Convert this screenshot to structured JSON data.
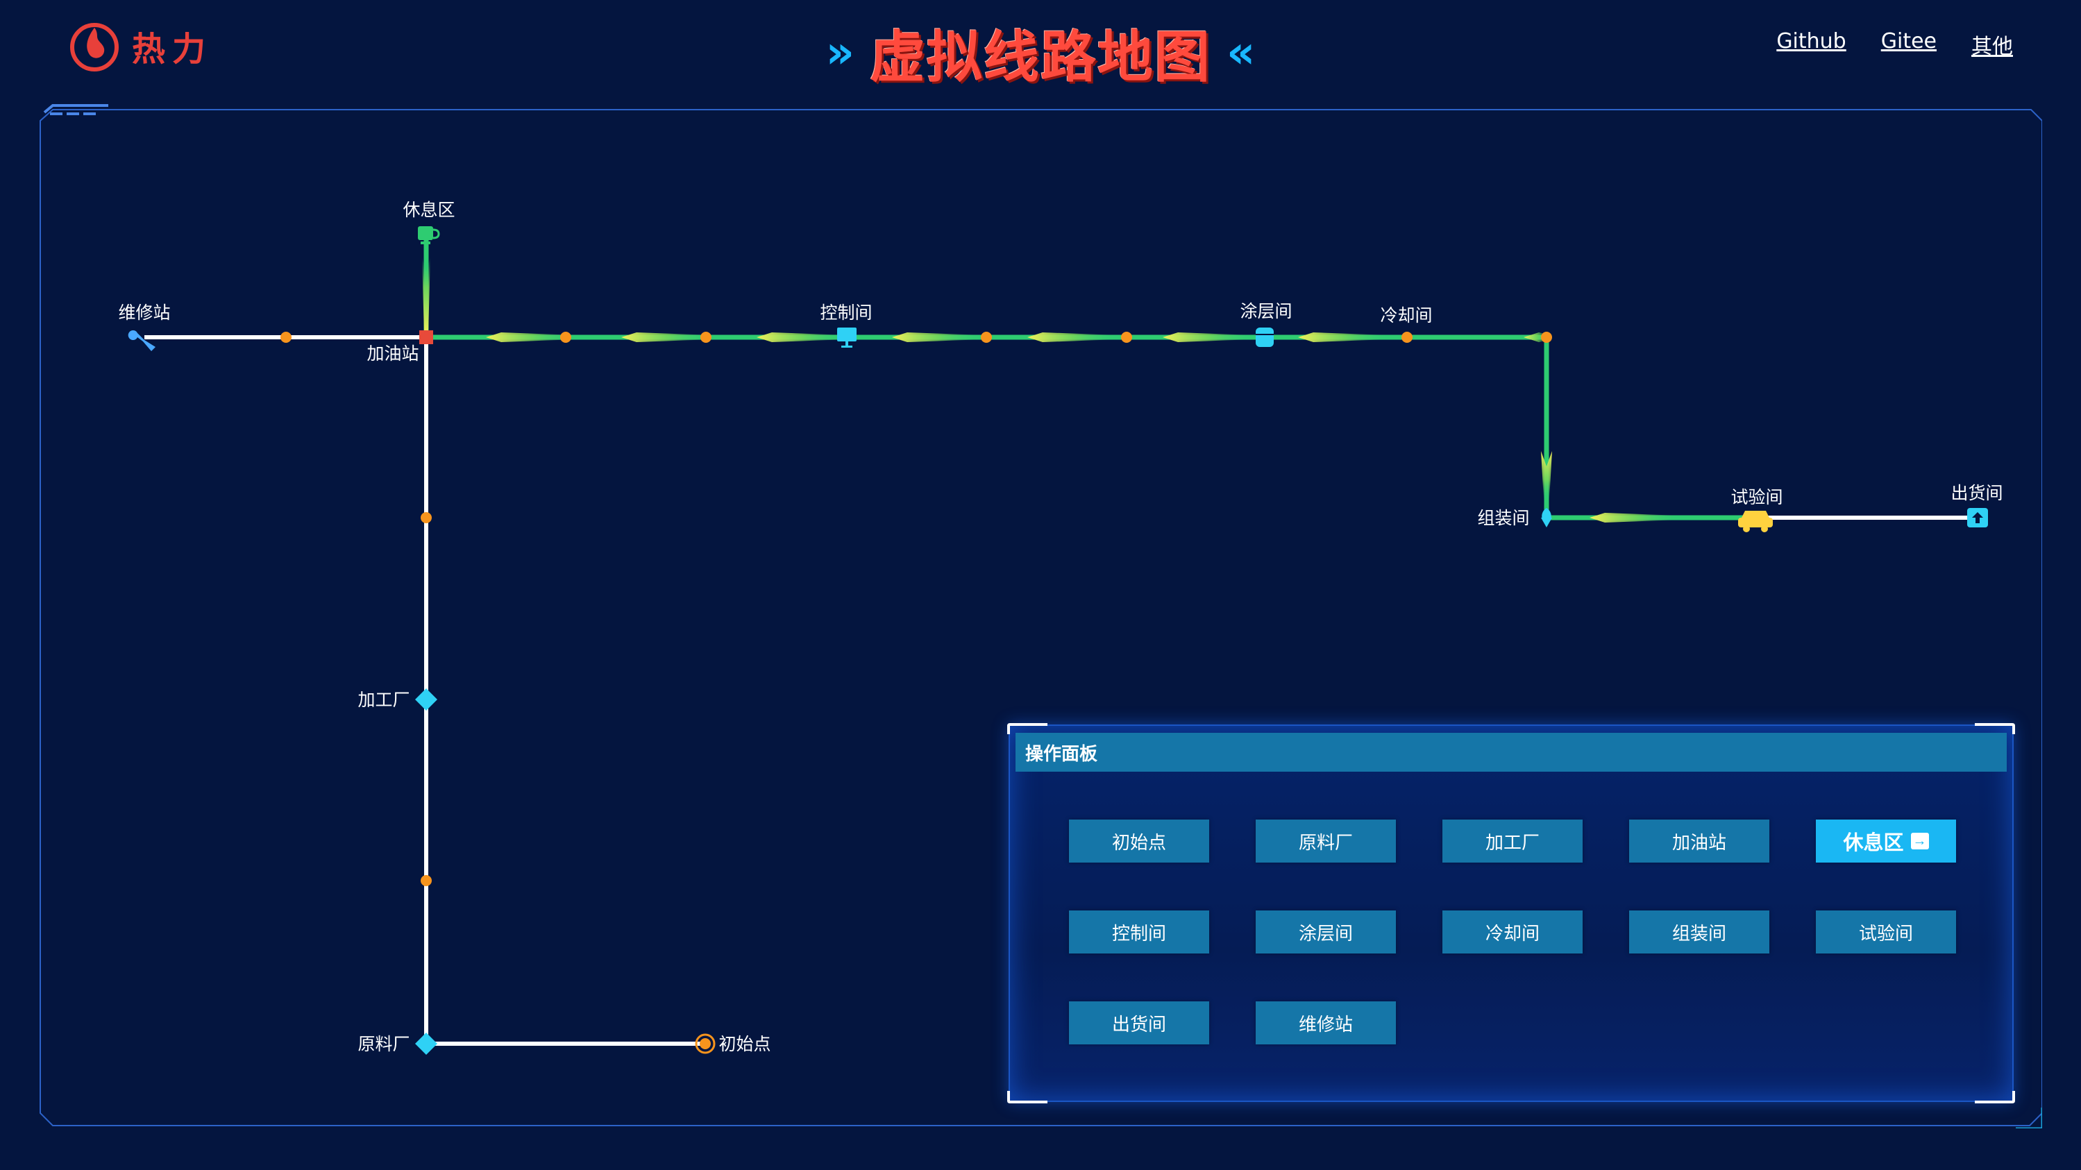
{
  "header": {
    "logo_text": "热力",
    "title": "虚拟线路地图",
    "nav": [
      "Github",
      "Gitee",
      "其他"
    ]
  },
  "map": {
    "nodes": {
      "rest": "休息区",
      "repair": "维修站",
      "fuel": "加油站",
      "control": "控制间",
      "coating": "涂层间",
      "cooling": "冷却间",
      "assembly": "组装间",
      "test": "试验间",
      "shipping": "出货间",
      "processing": "加工厂",
      "raw": "原料厂",
      "start": "初始点"
    },
    "colors": {
      "active_route": "#2ecc71",
      "inactive_route": "#ffffff",
      "waypoint": "#f7941d",
      "station": "#2fd1f5"
    }
  },
  "panel": {
    "title": "操作面板",
    "buttons": [
      "初始点",
      "原料厂",
      "加工厂",
      "加油站",
      "休息区",
      "控制间",
      "涂层间",
      "冷却间",
      "组装间",
      "试验间",
      "出货间",
      "维修站"
    ],
    "active": "休息区"
  }
}
